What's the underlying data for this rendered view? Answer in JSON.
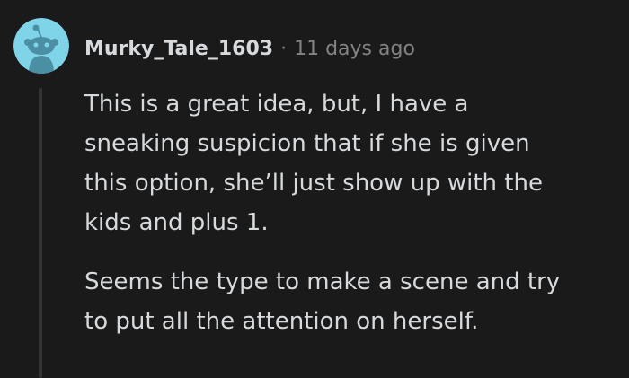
{
  "comment": {
    "author": "Murky_Tale_1603",
    "separator": "·",
    "timestamp": "11 days ago",
    "avatar_icon": "snoo-avatar-icon",
    "paragraphs": [
      "This is a great idea, but, I have a\nsneaking suspicion that if she is given\nthis option, she’ll just show up with the\nkids and plus 1.",
      "Seems the type to make a scene and try\nto put all the attention on herself."
    ]
  },
  "colors": {
    "background": "#1a1a1b",
    "text": "#d7dadc",
    "muted": "#818384",
    "avatar_bg": "#7fd4e8",
    "thread_line": "#343536"
  }
}
